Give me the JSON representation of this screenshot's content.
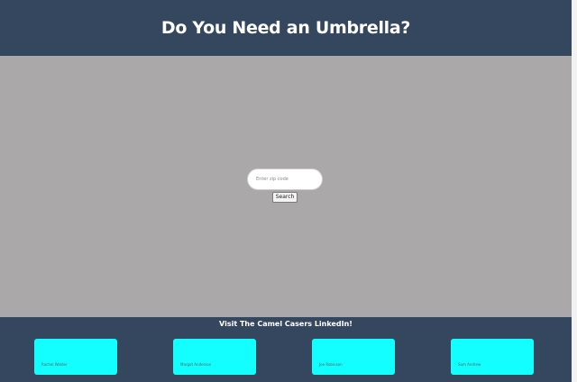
{
  "header": {
    "title": "Do You Need an Umbrella?"
  },
  "search": {
    "placeholder": "Enter zip code",
    "button_label": "Search"
  },
  "footer": {
    "title": "Visit The Camel Casers LinkedIn!",
    "links": [
      {
        "label": "Rachel Walder"
      },
      {
        "label": "Margot Anderson"
      },
      {
        "label": "Joe Robinson"
      },
      {
        "label": "Sam Andrew"
      }
    ]
  },
  "colors": {
    "header_bg": "#34475f",
    "main_bg": "#aaa8a9",
    "card_bg": "#13ffff"
  }
}
